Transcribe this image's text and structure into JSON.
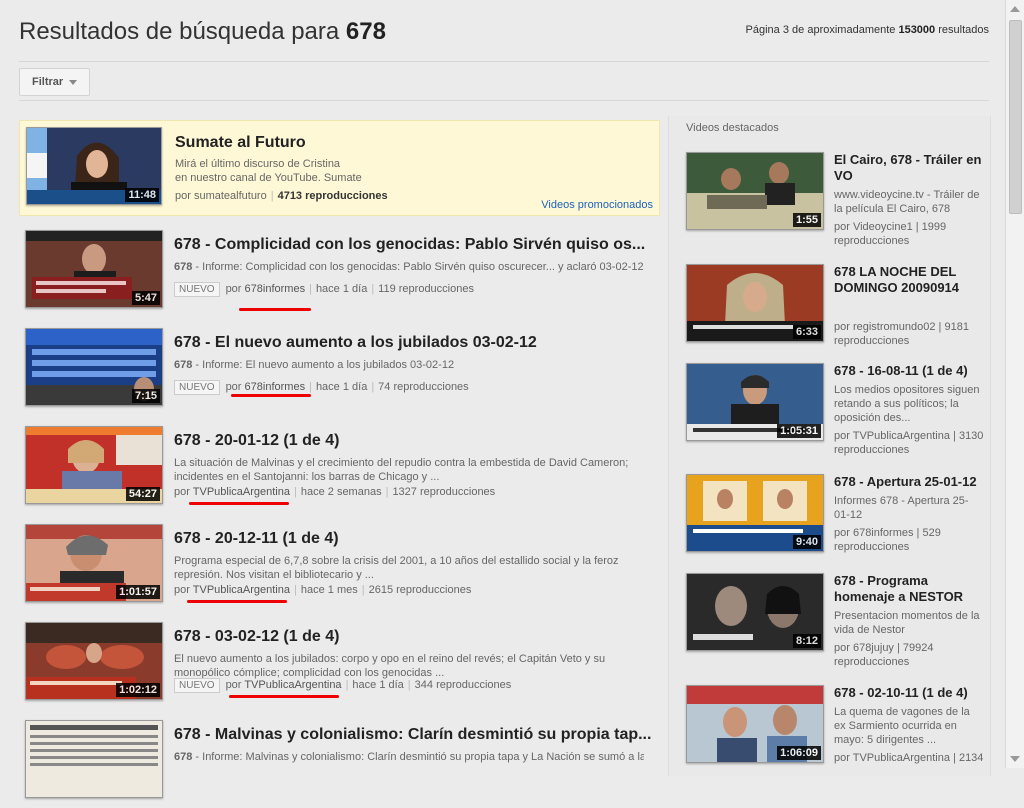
{
  "header": {
    "title_prefix": "Resultados de búsqueda para",
    "query": "678",
    "count_pre": "Página",
    "page": "3",
    "count_mid": "de aproximadamente",
    "total": "153000",
    "count_post": "resultados"
  },
  "filter": {
    "label": "Filtrar"
  },
  "promo": {
    "title": "Sumate al Futuro",
    "desc_line1": "Mirá el último discurso de Cristina",
    "desc_line2": "en nuestro canal de YouTube. Sumate",
    "by": "por sumatealfuturo",
    "views": "4713 reproducciones",
    "duration": "11:48",
    "link": "Videos promocionados"
  },
  "results": [
    {
      "title": "678 - Complicidad con los genocidas: Pablo Sirvén quiso os...",
      "desc_b": "678",
      "desc": " - Informe: Complicidad con los genocidas: Pablo Sirvén quiso oscurecer... y aclaró 03-02-12",
      "badge": "NUEVO",
      "by": "por",
      "channel": "678informes",
      "age": "hace 1 día",
      "views": "119 reproducciones",
      "duration": "5:47"
    },
    {
      "title": "678 - El nuevo aumento a los jubilados 03-02-12",
      "desc_b": "678",
      "desc": " - Informe: El nuevo aumento a los jubilados 03-02-12",
      "badge": "NUEVO",
      "by": "por",
      "channel": "678informes",
      "age": "hace 1 día",
      "views": "74 reproducciones",
      "duration": "7:15"
    },
    {
      "title": "678 - 20-01-12 (1 de 4)",
      "desc_b": "",
      "desc": "La situación de Malvinas y el crecimiento del repudio contra la embestida de David Cameron; incidentes en el Santojanni: los barras de Chicago y ...",
      "badge": "",
      "by": "por",
      "channel": "TVPublicaArgentina",
      "age": "hace 2 semanas",
      "views": "1327 reproducciones",
      "duration": "54:27"
    },
    {
      "title": "678 - 20-12-11 (1 de 4)",
      "desc_b": "",
      "desc": "Programa especial de 6,7,8 sobre la crisis del 2001, a 10 años del estallido social y la feroz represión. Nos visitan el bibliotecario y ...",
      "badge": "",
      "by": "por",
      "channel": "TVPublicaArgentina",
      "age": "hace 1 mes",
      "views": "2615 reproducciones",
      "duration": "1:01:57"
    },
    {
      "title": "678 - 03-02-12 (1 de 4)",
      "desc_b": "",
      "desc": "El nuevo aumento a los jubilados: corpo y opo en el reino del revés; el Capitán Veto y su monopólico cómplice; complicidad con los genocidas ...",
      "badge": "NUEVO",
      "by": "por",
      "channel": "TVPublicaArgentina",
      "age": "hace 1 día",
      "views": "344 reproducciones",
      "duration": "1:02:12"
    },
    {
      "title": "678 - Malvinas y colonialismo: Clarín desmintió su propia tap...",
      "desc_b": "678",
      "desc": " - Informe: Malvinas y colonialismo: Clarín desmintió su propia tapa y La Nación se sumó a la",
      "badge": "",
      "by": "",
      "channel": "",
      "age": "",
      "views": "",
      "duration": ""
    }
  ],
  "sidebar": {
    "heading": "Videos destacados",
    "items": [
      {
        "title": "El Cairo, 678 - Tráiler en VO",
        "desc": "www.videoycine.tv - Tráiler de la película El Cairo, 678",
        "meta": "por Videoycine1 | 1999 reproducciones",
        "duration": "1:55"
      },
      {
        "title": "678 LA NOCHE DEL DOMINGO 20090914",
        "desc": "",
        "meta": "por registromundo02 | 9181 reproducciones",
        "duration": "6:33"
      },
      {
        "title": "678 - 16-08-11 (1 de 4)",
        "desc": "Los medios opositores siguen retando a sus políticos; la oposición des...",
        "meta": "por TVPublicaArgentina | 3130 reproducciones",
        "duration": "1:05:31"
      },
      {
        "title": "678 - Apertura 25-01-12",
        "desc": "Informes 678 - Apertura 25-01-12",
        "meta": "por 678informes | 529 reproducciones",
        "duration": "9:40"
      },
      {
        "title": "678 - Programa homenaje a NESTOR",
        "desc": "Presentacion momentos de la vida de Nestor",
        "meta": "por 678jujuy | 79924 reproducciones",
        "duration": "8:12"
      },
      {
        "title": "678 - 02-10-11 (1 de 4)",
        "desc": "La quema de vagones de la ex Sarmiento ocurrida en mayo: 5 dirigentes ...",
        "meta": "por TVPublicaArgentina | 2134",
        "duration": "1:06:09"
      }
    ]
  },
  "colors": {
    "promo_bg": "#fff8d6",
    "link": "#1c62b9",
    "annotation": "#e00000"
  }
}
